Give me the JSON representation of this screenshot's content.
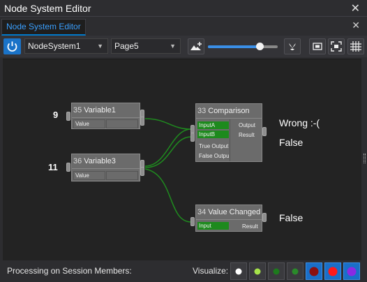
{
  "window": {
    "title": "Node System Editor",
    "close": "✕"
  },
  "tabs": [
    {
      "label": "Node System Editor",
      "close": "✕"
    }
  ],
  "toolbar": {
    "node_system": "NodeSystem1",
    "page": "Page5",
    "zoom_level": 0.74,
    "icons": [
      "power-icon",
      "image-add-icon",
      "flower-icon",
      "fit-icon",
      "expand-icon",
      "grid-icon"
    ]
  },
  "nodes": {
    "variable1": {
      "id": "35",
      "name": "Variable1",
      "row": "Value",
      "input_value": "9"
    },
    "variable3": {
      "id": "36",
      "name": "Variable3",
      "row": "Value",
      "input_value": "11"
    },
    "comparison": {
      "id": "33",
      "name": "Comparison",
      "inputs": [
        "InputA",
        "InputB",
        "True Output",
        "False Output"
      ],
      "outputs": [
        "Output",
        "Result"
      ],
      "result_labels": [
        "Wrong :-(",
        "False"
      ]
    },
    "value_changed": {
      "id": "34",
      "name": "Value Changed",
      "inputs": [
        "Input"
      ],
      "outputs": [
        "Result"
      ],
      "result_label": "False"
    }
  },
  "status": {
    "processing_label": "Processing on Session Members:",
    "visualize_label": "Visualize:",
    "visualize_colors": [
      "#ffffff",
      "#a6e34a",
      "#1d7a1d",
      "#2a8a2a",
      "#8b1010",
      "#ff1a1a",
      "#8a2be2"
    ],
    "selected": [
      4,
      5,
      6
    ]
  },
  "colors": {
    "accent": "#007acc",
    "active_input": "#1d8a1d",
    "wire": "#1f8a1f"
  }
}
